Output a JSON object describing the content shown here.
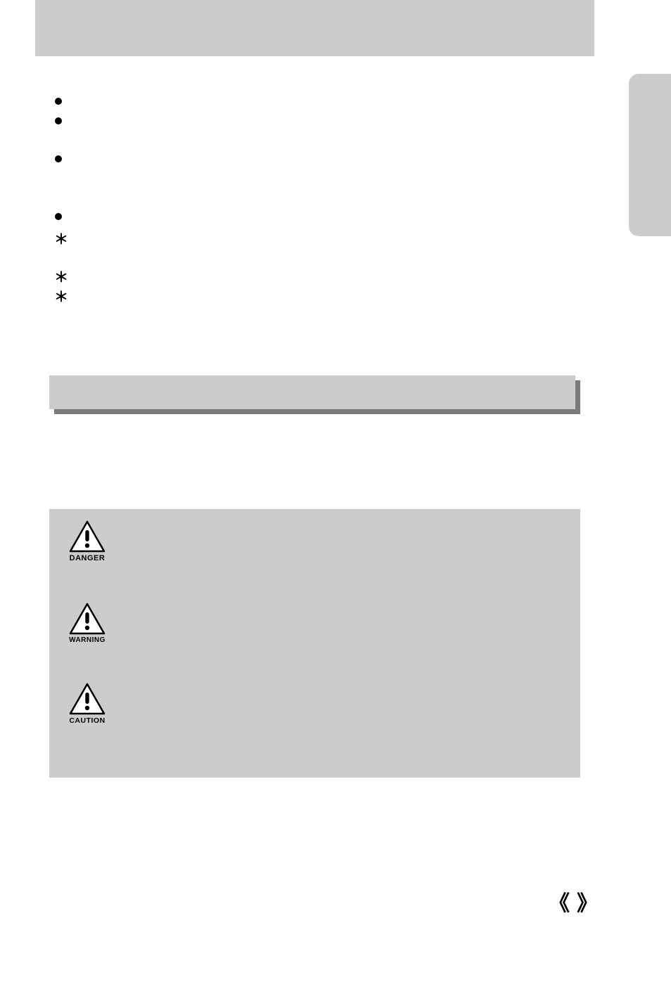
{
  "bullets": [
    "",
    "",
    "",
    ""
  ],
  "asterisks": [
    "＊",
    "＊",
    "＊"
  ],
  "icons": {
    "danger": "DANGER",
    "warning": "WARNING",
    "caution": "CAUTION"
  },
  "footer": {
    "left_brace": "《",
    "right_brace": "》"
  }
}
